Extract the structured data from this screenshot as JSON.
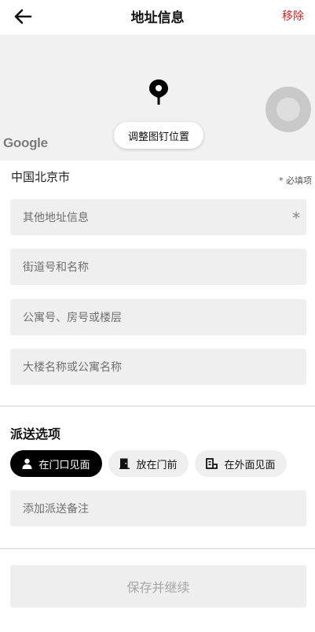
{
  "header": {
    "title": "地址信息",
    "remove_label": "移除",
    "remove_color": "#d32323"
  },
  "map": {
    "adjust_pin_label": "调整图钉位置",
    "logo_text": "Google"
  },
  "address": {
    "city": "中国北京市",
    "required_note": "* 必填项",
    "fields": [
      {
        "placeholder": "其他地址信息",
        "required_mark": "*"
      },
      {
        "placeholder": "街道号和名称"
      },
      {
        "placeholder": "公寓号、房号或楼层"
      },
      {
        "placeholder": "大楼名称或公寓名称"
      }
    ]
  },
  "delivery": {
    "title": "派送选项",
    "options": [
      {
        "label": "在门口见面",
        "icon": "person-icon",
        "selected": true
      },
      {
        "label": "放在门前",
        "icon": "door-icon",
        "selected": false
      },
      {
        "label": "在外面见面",
        "icon": "building-icon",
        "selected": false
      }
    ],
    "notes_placeholder": "添加派送备注"
  },
  "footer": {
    "save_label": "保存并继续"
  }
}
